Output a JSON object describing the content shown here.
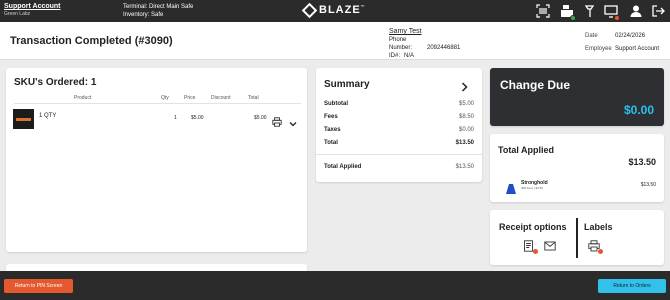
{
  "topbar": {
    "account_name": "Support Account",
    "account_sub": "Green Labz",
    "terminal": "Terminal: Direct Main Safe",
    "inventory": "Inventory: Safe",
    "logo_text": "BLAZE",
    "logo_tm": "™"
  },
  "header": {
    "title": "Transaction Completed (#3090)",
    "customer_name": "Samy Test",
    "phone_label": "Phone Number:",
    "phone_value": "2092446881",
    "id_label": "ID#:",
    "id_value": "N/A",
    "date_label": "Date",
    "date_value": "02/24/2026",
    "employee_label": "Employee",
    "employee_value": "Support Account"
  },
  "skus": {
    "title": "SKU's Ordered: 1",
    "columns": [
      "Product",
      "Qty",
      "Price",
      "Discount",
      "Total"
    ],
    "rows": [
      {
        "name": "1 QTY",
        "qty": "1",
        "price": "$5.00",
        "discount": "",
        "total": "$5.00"
      }
    ]
  },
  "summary": {
    "title": "Summary",
    "rows": [
      {
        "label": "Subtotal",
        "value": "$5.00"
      },
      {
        "label": "Fees",
        "value": "$8.50"
      },
      {
        "label": "Taxes",
        "value": "$0.00"
      },
      {
        "label": "Total",
        "value": "$13.50"
      }
    ],
    "applied_label": "Total Applied",
    "applied_value": "$13.50"
  },
  "change": {
    "title": "Change Due",
    "amount": "$0.00"
  },
  "applied": {
    "title": "Total Applied",
    "amount": "$13.50",
    "payment_name": "Stronghold",
    "payment_sub": "(Bill Fee) | $3.50",
    "payment_amount": "$13.50"
  },
  "receipt": {
    "title": "Receipt options",
    "labels_title": "Labels"
  },
  "footer": {
    "pin_label": "Return to PIN Screen",
    "orders_label": "Return to Orders"
  },
  "colors": {
    "accent_blue": "#31c1ea",
    "accent_orange": "#e45a2e",
    "dark": "#2b2b2b"
  },
  "icons": [
    "scan-icon",
    "register-icon",
    "tools-icon",
    "monitor-icon",
    "user-icon",
    "logout-icon",
    "printer-icon",
    "chevron-down-icon",
    "chevron-right-icon",
    "receipt-icon",
    "mail-icon",
    "label-printer-icon",
    "stronghold-icon"
  ]
}
